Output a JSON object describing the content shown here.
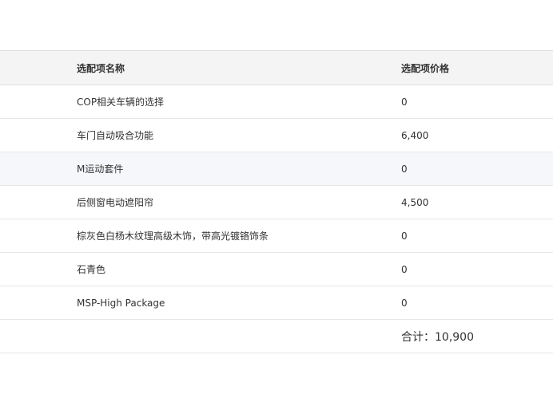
{
  "table": {
    "headers": {
      "name": "选配项名称",
      "price": "选配项价格"
    },
    "rows": [
      {
        "name": "COP相关车辆的选择",
        "price": "0"
      },
      {
        "name": "车门自动吸合功能",
        "price": "6,400"
      },
      {
        "name": "M运动套件",
        "price": "0"
      },
      {
        "name": "后侧窗电动遮阳帘",
        "price": "4,500"
      },
      {
        "name": "棕灰色白杨木纹理高级木饰，带高光镀铬饰条",
        "price": "0"
      },
      {
        "name": "石青色",
        "price": "0"
      },
      {
        "name": "MSP-High Package",
        "price": "0"
      }
    ],
    "total": "合计：10,900"
  }
}
